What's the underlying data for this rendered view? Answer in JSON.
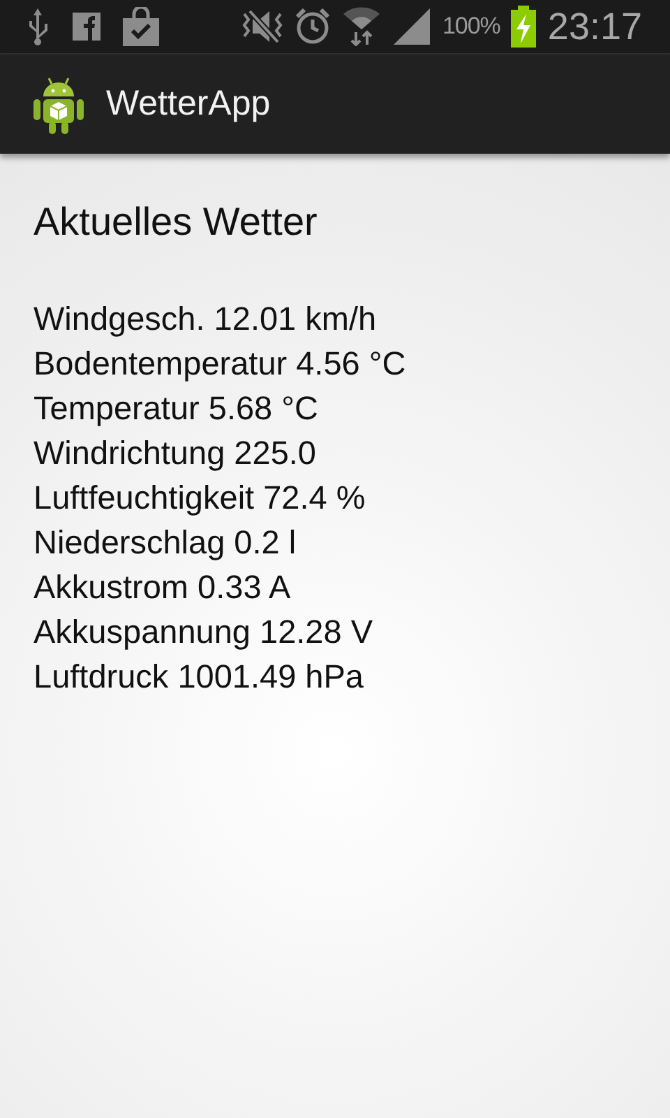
{
  "status_bar": {
    "battery": "100%",
    "time": "23:17"
  },
  "action_bar": {
    "title": "WetterApp"
  },
  "heading": "Aktuelles Wetter",
  "readings": [
    "Windgesch. 12.01 km/h",
    "Bodentemperatur 4.56 °C",
    "Temperatur 5.68 °C",
    "Windrichtung 225.0",
    "Luftfeuchtigkeit 72.4 %",
    "Niederschlag 0.2 l",
    "Akkustrom 0.33 A",
    "Akkuspannung 12.28 V",
    "Luftdruck 1001.49 hPa"
  ]
}
